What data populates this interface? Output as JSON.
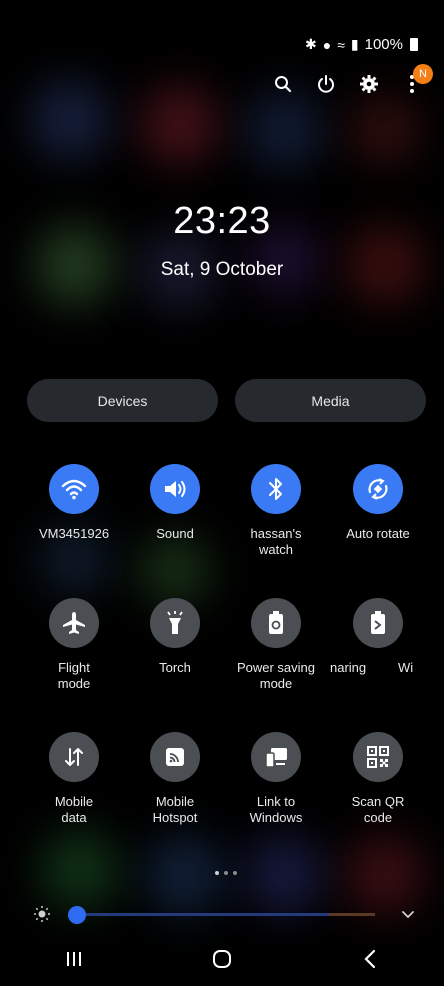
{
  "status_bar": {
    "battery": "100%",
    "icons": [
      "bluetooth-icon",
      "location-icon",
      "wifi-icon",
      "signal-icon",
      "battery-icon"
    ]
  },
  "top_actions": {
    "icons": [
      "search-icon",
      "power-icon",
      "gear-icon",
      "more-icon"
    ],
    "notification_badge": "N"
  },
  "lockscreen": {
    "time": "23:23",
    "date": "Sat, 9 October"
  },
  "tabs": {
    "devices": "Devices",
    "media": "Media"
  },
  "tiles": [
    {
      "label": "VM3451926",
      "icon": "wifi-icon",
      "state": "on"
    },
    {
      "label": "Sound",
      "icon": "speaker-icon",
      "state": "on"
    },
    {
      "label": "hassan's\nwatch",
      "icon": "bluetooth-icon",
      "state": "on"
    },
    {
      "label": "Auto rotate",
      "icon": "rotate-icon",
      "state": "on"
    },
    {
      "label": "Flight\nmode",
      "icon": "airplane-icon",
      "state": "off"
    },
    {
      "label": "Torch",
      "icon": "flashlight-icon",
      "state": "off"
    },
    {
      "label": "Power saving\nmode",
      "icon": "battery-saver-icon",
      "state": "off"
    },
    {
      "label": "naring",
      "icon": "battery-share-icon",
      "state": "off"
    },
    {
      "label": "Wi",
      "icon": "wifi-call-icon",
      "state": "off"
    },
    {
      "label": "Mobile\ndata",
      "icon": "data-arrows-icon",
      "state": "off"
    },
    {
      "label": "Mobile\nHotspot",
      "icon": "hotspot-icon",
      "state": "off"
    },
    {
      "label": "Link to\nWindows",
      "icon": "link-windows-icon",
      "state": "off"
    },
    {
      "label": "Scan QR\ncode",
      "icon": "qr-code-icon",
      "state": "off"
    }
  ],
  "pager": {
    "pages": 3,
    "active": 0
  },
  "brightness": {
    "level": 0.03
  },
  "colors": {
    "accent": "#3a7bf5",
    "tile_off": "#4b4e53",
    "badge": "#f57f17"
  }
}
